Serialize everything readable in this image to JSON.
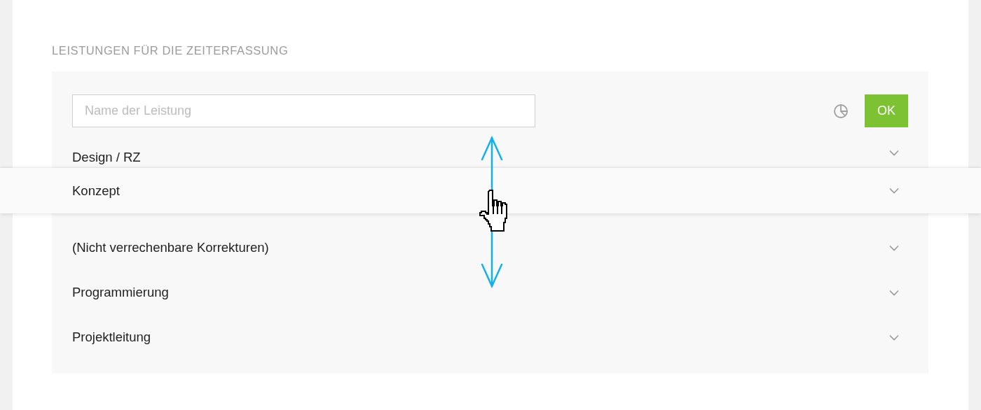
{
  "heading": "LEISTUNGEN FÜR DIE ZEITERFASSUNG",
  "search": {
    "placeholder": "Name der Leistung"
  },
  "ok_button": "OK",
  "services": [
    {
      "name": "Design / RZ",
      "kind": "item"
    },
    {
      "name": "Konzept",
      "kind": "dragging"
    },
    {
      "name": "(Nicht verrechenbare Korrekturen)",
      "kind": "item"
    },
    {
      "name": "Programmierung",
      "kind": "item"
    },
    {
      "name": "Projektleitung",
      "kind": "item"
    }
  ]
}
